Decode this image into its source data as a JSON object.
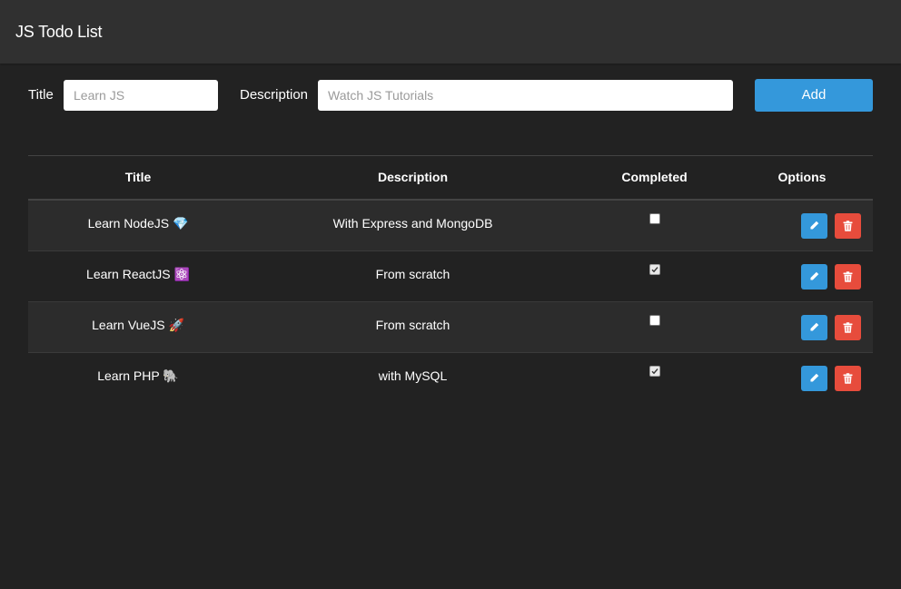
{
  "app": {
    "title": "JS Todo List"
  },
  "form": {
    "title_label": "Title",
    "title_placeholder": "Learn JS",
    "title_value": "",
    "description_label": "Description",
    "description_placeholder": "Watch JS Tutorials",
    "description_value": "",
    "add_label": "Add"
  },
  "table": {
    "headers": {
      "title": "Title",
      "description": "Description",
      "completed": "Completed",
      "options": "Options"
    },
    "rows": [
      {
        "title": "Learn NodeJS 💎",
        "description": "With Express and MongoDB",
        "completed": false
      },
      {
        "title": "Learn ReactJS ⚛️",
        "description": "From scratch",
        "completed": true
      },
      {
        "title": "Learn VueJS 🚀",
        "description": "From scratch",
        "completed": false
      },
      {
        "title": "Learn PHP 🐘",
        "description": "with MySQL",
        "completed": true
      }
    ]
  },
  "icons": {
    "edit": "pencil-icon",
    "delete": "trash-icon"
  },
  "colors": {
    "background": "#222222",
    "navbar": "#303030",
    "primary": "#3498db",
    "danger": "#e74c3c",
    "row_striped": "#2c2c2c"
  }
}
